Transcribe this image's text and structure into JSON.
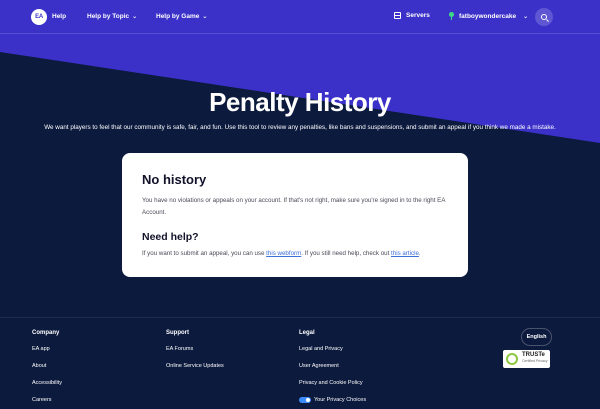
{
  "header": {
    "logo_text": "EA",
    "help_label": "Help",
    "nav": [
      {
        "label": "Help by Topic"
      },
      {
        "label": "Help by Game"
      }
    ],
    "servers_label": "Servers",
    "username": "fatboywondercake"
  },
  "hero": {
    "title": "Penalty History",
    "intro": "We want players to feel that our community is safe, fair, and fun. Use this tool to review any penalties, like bans and suspensions, and submit an appeal if you think we made a mistake."
  },
  "card": {
    "heading": "No history",
    "body": "You have no violations or appeals on your account. If that's not right, make sure you're signed in to the right EA Account.",
    "help_heading": "Need help?",
    "help_prefix": "If you want to submit an appeal, you can use ",
    "webform_link": "this webform",
    "help_middle": ". If you still need help, check out ",
    "article_link": "this article",
    "help_suffix": "."
  },
  "footer": {
    "company": {
      "heading": "Company",
      "links": [
        "EA app",
        "About",
        "Accessibility",
        "Careers"
      ]
    },
    "support": {
      "heading": "Support",
      "links": [
        "EA Forums",
        "Online Service Updates"
      ]
    },
    "legal": {
      "heading": "Legal",
      "links": [
        "Legal and Privacy",
        "User Agreement",
        "Privacy and Cookie Policy",
        "Your Privacy Choices"
      ]
    },
    "language": "English",
    "badge": {
      "name": "TRUSTe",
      "sub": "Certified Privacy"
    }
  },
  "colors": {
    "brand_purple": "#3b31c9",
    "navy": "#0c1a3d",
    "link": "#3b6fd9",
    "status_green": "#3ddc84"
  }
}
